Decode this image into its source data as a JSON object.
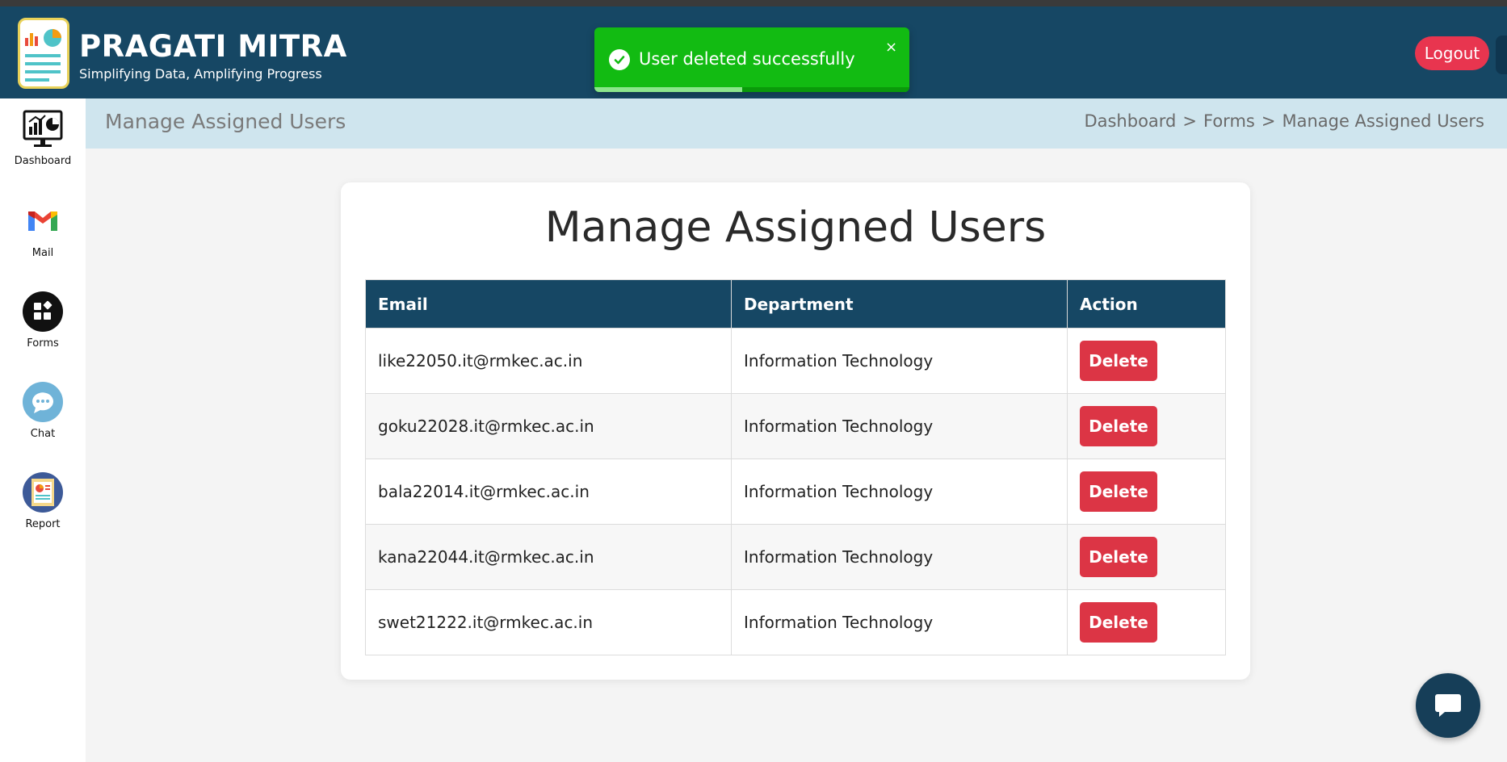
{
  "header": {
    "brand_title": "PRAGATI MITRA",
    "brand_subtitle": "Simplifying Data, Amplifying Progress",
    "logout_label": "Logout"
  },
  "toast": {
    "message": "User deleted successfully",
    "close_glyph": "×",
    "progress_fraction": 0.47,
    "color": "#12bb12"
  },
  "sidebar": {
    "items": [
      {
        "label": "Dashboard",
        "icon": "dashboard-monitor-icon"
      },
      {
        "label": "Mail",
        "icon": "gmail-icon"
      },
      {
        "label": "Forms",
        "icon": "forms-icon"
      },
      {
        "label": "Chat",
        "icon": "chat-bubble-icon"
      },
      {
        "label": "Report",
        "icon": "report-icon"
      }
    ]
  },
  "subheader": {
    "title": "Manage Assigned Users",
    "breadcrumb": [
      "Dashboard",
      "Forms",
      "Manage Assigned Users"
    ],
    "separator": ">"
  },
  "main": {
    "title": "Manage Assigned Users",
    "table": {
      "headers": [
        "Email",
        "Department",
        "Action"
      ],
      "rows": [
        {
          "email": "like22050.it@rmkec.ac.in",
          "department": "Information Technology",
          "action": "Delete"
        },
        {
          "email": "goku22028.it@rmkec.ac.in",
          "department": "Information Technology",
          "action": "Delete"
        },
        {
          "email": "bala22014.it@rmkec.ac.in",
          "department": "Information Technology",
          "action": "Delete"
        },
        {
          "email": "kana22044.it@rmkec.ac.in",
          "department": "Information Technology",
          "action": "Delete"
        },
        {
          "email": "swet21222.it@rmkec.ac.in",
          "department": "Information Technology",
          "action": "Delete"
        }
      ]
    }
  },
  "colors": {
    "header_bg": "#164764",
    "delete_button": "#dc3545",
    "logout_button": "#e8354f",
    "subheader_bg": "#cfe5ee"
  }
}
